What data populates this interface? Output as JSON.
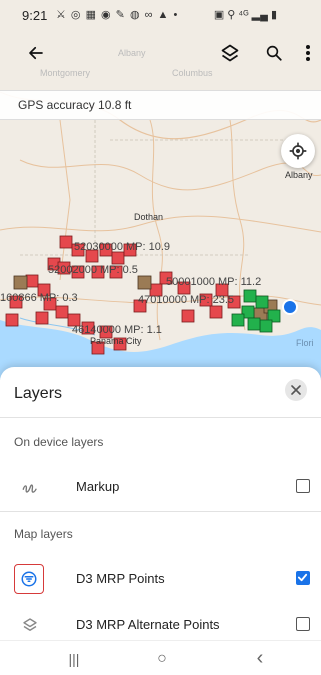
{
  "status_bar": {
    "time": "9:21",
    "notification_icons": "⚔ ◎ ▦ ◉ ✎ ◍ ∞ ▲ •",
    "system_icons": "▣ ⚲ ⁴ᴳ ▂▄ ▮"
  },
  "app_bar": {
    "back_icon": "arrow-left-icon",
    "layers_icon": "layers-icon",
    "search_icon": "search-icon",
    "more_icon": "more-vert-icon"
  },
  "gps": {
    "text": "GPS accuracy 10.8 ft"
  },
  "map": {
    "towns": [
      "Albany",
      "Dothan",
      "Panama City",
      "Flori"
    ],
    "faded_towns": [
      "Albany",
      "Montgomery",
      "Columbus"
    ],
    "markers_text": [
      "52030000 MP: 10.9",
      "52002000 MP: 0.5",
      "50001000 MP: 11.2",
      "160866 MP: 0.3",
      "47010000 MP: 23.5",
      "46140000 MP: 1.1"
    ],
    "colors": {
      "red": "#e5484d",
      "green": "#22b14c",
      "brown": "#9b7b55",
      "location": "#1a73e8"
    }
  },
  "sheet": {
    "title": "Layers",
    "section_on_device": "On device layers",
    "section_map": "Map layers",
    "rows": [
      {
        "label": "Markup",
        "icon": "markup-icon",
        "checked": false
      },
      {
        "label": "D3 MRP Points",
        "icon": "filter-icon",
        "checked": true
      },
      {
        "label": "D3 MRP Alternate Points",
        "icon": "layer-icon",
        "checked": false
      }
    ]
  },
  "nav_bar": {
    "recents": "|||",
    "home": "○",
    "back": "‹"
  }
}
